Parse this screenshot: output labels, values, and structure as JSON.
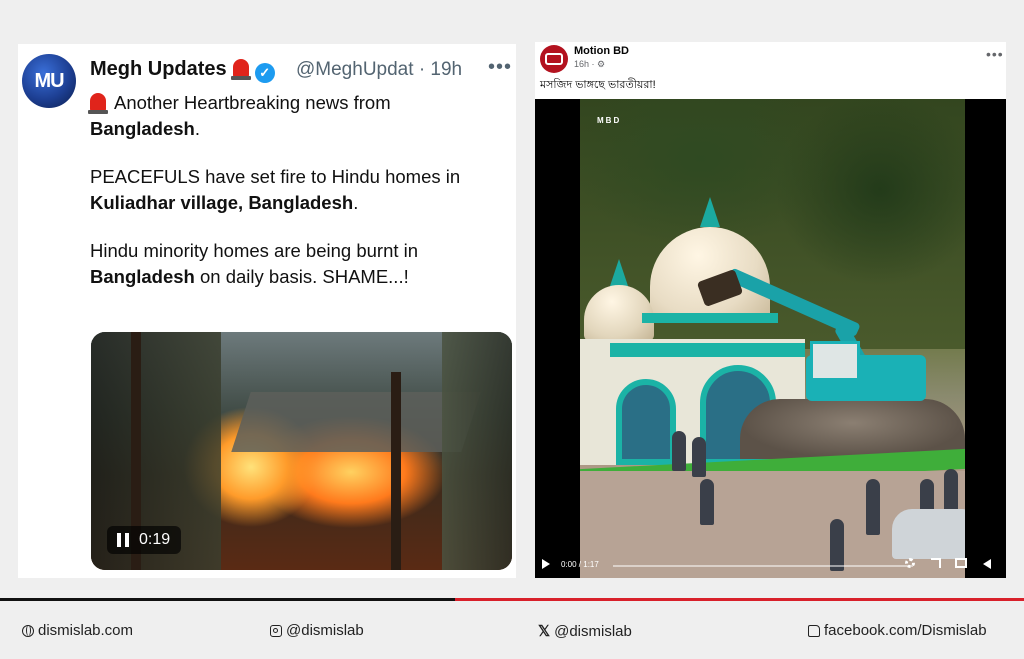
{
  "tweet": {
    "avatar_text": "MU",
    "name": "Megh Updates",
    "handle": "@MeghUpdat",
    "time": "· 19h",
    "more": "•••",
    "line1_prefix": "Another Heartbreaking news from",
    "line1_bold": "Bangladesh",
    "line1_suffix": ".",
    "para2_prefix": "PEACEFULS have set fire to Hindu homes in",
    "para2_bold": "Kuliadhar village, Bangladesh",
    "para2_suffix": ".",
    "para3_prefix": "Hindu minority homes are being burnt in",
    "para3_bold": "Bangladesh",
    "para3_suffix": "on daily basis. SHAME...!",
    "video_time": "0:19"
  },
  "fb_post": {
    "page_name": "Motion BD",
    "meta": "16h · ⚙",
    "more": "•••",
    "caption": "মসজিদ ভাঙ্গছে ভারতীয়রা!",
    "watermark": "MBD",
    "video_time": "0:00 / 1:17"
  },
  "footer": {
    "website": "dismislab.com",
    "instagram": "@dismislab",
    "x": "@dismislab",
    "facebook": "facebook.com/Dismislab"
  },
  "colors": {
    "accent_red": "#d8202a",
    "twitter_blue": "#1d9bf0"
  }
}
